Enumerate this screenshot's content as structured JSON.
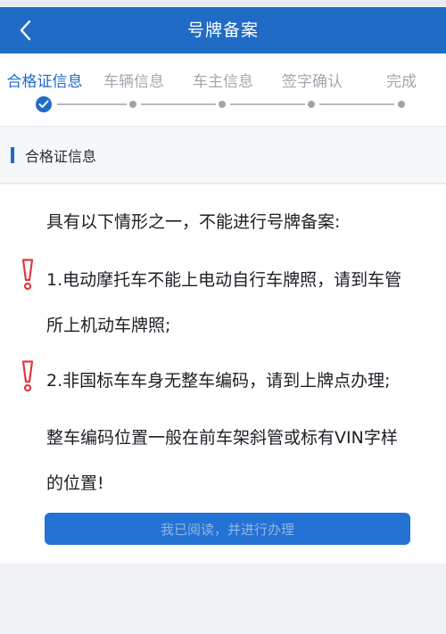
{
  "header": {
    "title": "号牌备案"
  },
  "steps": [
    {
      "label": "合格证信息",
      "state": "done"
    },
    {
      "label": "车辆信息",
      "state": "pending"
    },
    {
      "label": "车主信息",
      "state": "pending"
    },
    {
      "label": "签字确认",
      "state": "pending"
    },
    {
      "label": "完成",
      "state": "pending"
    }
  ],
  "section": {
    "title": "合格证信息"
  },
  "notice": {
    "intro": "具有以下情形之一，不能进行号牌备案:",
    "item1_line1": "1.电动摩托车不能上电动自行车牌照，请到车管",
    "item1_line2": "所上机动车牌照;",
    "item2": "2.非国标车车身无整车编码，请到上牌点办理;",
    "tip_line1": "整车编码位置一般在前车架斜管或标有VIN字样",
    "tip_line2": "的位置!"
  },
  "actions": {
    "confirm_label": "我已阅读，并进行办理"
  },
  "colors": {
    "primary": "#1f6bc6",
    "warning": "#e0393e",
    "inactive": "#a3a8b0"
  },
  "icons": {
    "back": "chevron-left-icon",
    "step_done": "check-icon",
    "warning": "exclamation-icon"
  }
}
